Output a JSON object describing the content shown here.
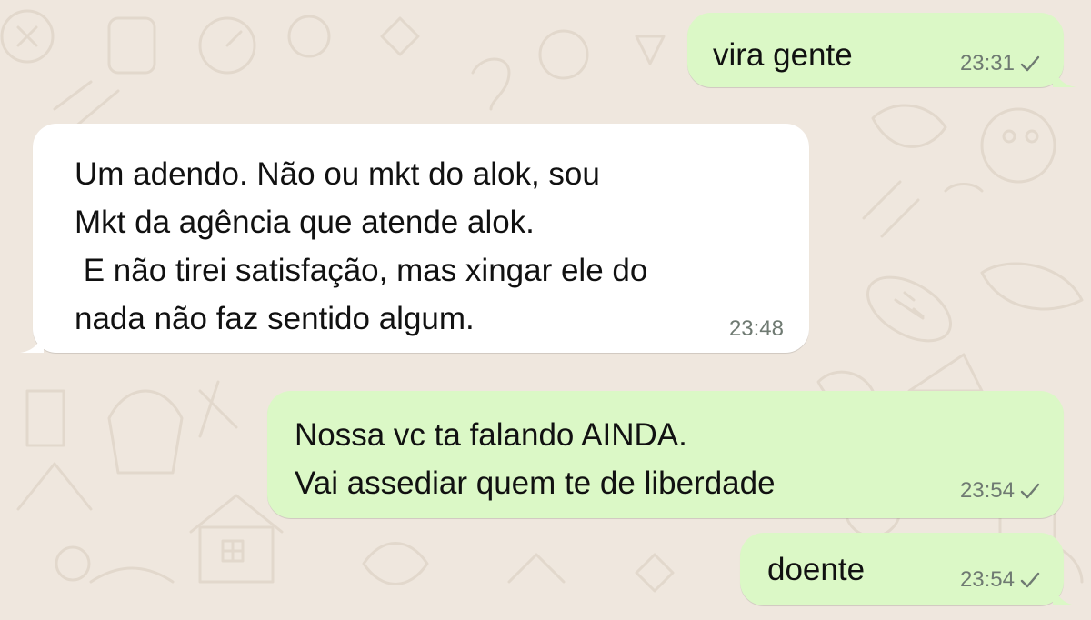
{
  "conversation": {
    "messages": [
      {
        "direction": "outgoing",
        "text": "vira gente",
        "time": "23:31",
        "status_icon": "single-check-icon"
      },
      {
        "direction": "incoming",
        "text": "Um adendo. Não ou mkt do alok, sou\nMkt da agência que atende alok.\n E não tirei satisfação, mas xingar ele do\nnada não faz sentido algum.",
        "time": "23:48"
      },
      {
        "direction": "outgoing",
        "text": "Nossa vc ta falando AINDA.\nVai assediar quem te de liberdade",
        "time": "23:54",
        "status_icon": "single-check-icon"
      },
      {
        "direction": "outgoing",
        "text": "doente",
        "time": "23:54",
        "status_icon": "single-check-icon"
      }
    ]
  },
  "colors": {
    "wallpaper": "#efe7de",
    "outgoing_bubble": "#dbf8c6",
    "incoming_bubble": "#ffffff",
    "timestamp": "#6f7a72"
  }
}
